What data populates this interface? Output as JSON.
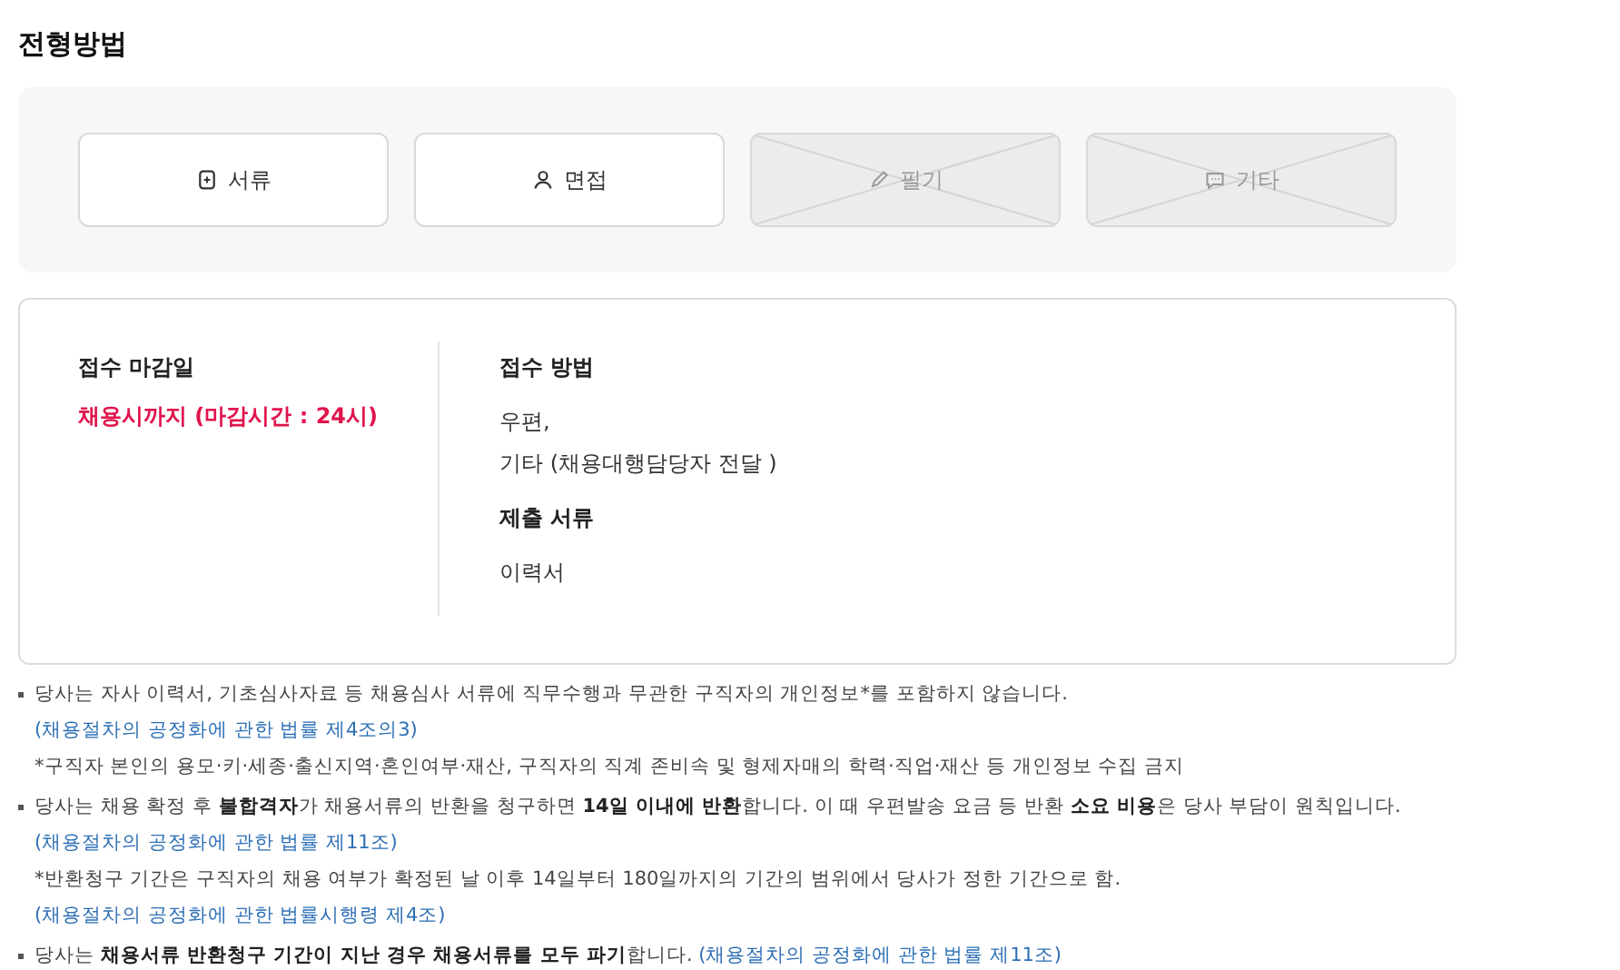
{
  "title": "전형방법",
  "stages": [
    {
      "label": "서류",
      "enabled": true
    },
    {
      "label": "면접",
      "enabled": true
    },
    {
      "label": "필기",
      "enabled": false
    },
    {
      "label": "기타",
      "enabled": false
    }
  ],
  "deadline": {
    "label": "접수 마감일",
    "value": "채용시까지 (마감시간 : 24시)"
  },
  "method": {
    "label": "접수 방법",
    "lines": [
      "우편,",
      "기타 (채용대행담당자 전달 )"
    ]
  },
  "documents": {
    "label": "제출 서류",
    "lines": [
      "이력서"
    ]
  },
  "notes": [
    {
      "text": "당사는 자사 이력서, 기초심사자료 등 채용심사 서류에 직무수행과 무관한 구직자의 개인정보*를 포함하지 않습니다.",
      "link": "(채용절차의 공정화에 관한 법률 제4조의3)",
      "sub": "*구직자 본인의 용모·키·세종·출신지역·혼인여부·재산, 구직자의 직계 존비속 및 형제자매의 학력·직업·재산 등 개인정보 수집 금지"
    },
    {
      "text": "당사는 채용 확정 후 **불합격자**가 채용서류의 반환을 청구하면 **14일 이내에 반환**합니다. 이 때 우편발송 요금 등 반환 **소요 비용**은 당사 부담이 원칙입니다.",
      "link": "(채용절차의 공정화에 관한 법률 제11조)",
      "sub": "*반환청구 기간은 구직자의 채용 여부가 확정된 날 이후 14일부터 180일까지의 기간의 범위에서 당사가 정한 기간으로 함.",
      "sub_link": "(채용절차의 공정화에 관한 법률시행령 제4조)"
    },
    {
      "text": "당사는 **채용서류 반환청구 기간이 지난 경우 채용서류를 모두 파기**합니다.",
      "link": "(채용절차의 공정화에 관한 법률 제11조)"
    }
  ]
}
